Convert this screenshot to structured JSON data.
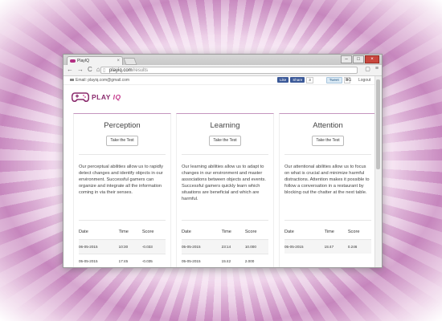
{
  "browser": {
    "tab_title": "PlayIQ",
    "tab_close": "×",
    "url_domain": "playiq.com",
    "url_path": "/results",
    "nav": {
      "back": "←",
      "forward": "→",
      "reload": "C",
      "home": "⌂"
    },
    "window_buttons": {
      "minimize": "–",
      "maximize": "□",
      "close": "×"
    },
    "menu": "≡",
    "extension": "▢"
  },
  "header": {
    "email_label": "Email: playiq.com@gmail.com",
    "fb_like": "Like",
    "fb_share": "Share",
    "fb_count": "3",
    "tweet": "Tweet",
    "tweet_count": "0",
    "language": "BG",
    "logout": "Logout"
  },
  "logo": {
    "play": "PLAY",
    "iq": "IQ",
    "brand_color": "#8a2b6d"
  },
  "cards": [
    {
      "title": "Perception",
      "button": "Take the Test",
      "description": "Our perceptual abilities allow us to rapidly detect changes and identify objects in our environment. Successful gamers can organize and integrate all the information coming in via their senses.",
      "columns": [
        "Date",
        "Time",
        "Score"
      ],
      "rows": [
        [
          "06-05-2015",
          "10:30",
          "-0.033"
        ],
        [
          "05-05-2015",
          "17:45",
          "-0.035"
        ]
      ]
    },
    {
      "title": "Learning",
      "button": "Take the Test",
      "description": "Our learning abilities allow us to adapt to changes in our environment and master associations between objects and events. Successful gamers quickly learn which situations are beneficial and which are harmful.",
      "columns": [
        "Date",
        "Time",
        "Score"
      ],
      "rows": [
        [
          "05-05-2015",
          "23:14",
          "10.000"
        ],
        [
          "05-05-2015",
          "15:42",
          "2.000"
        ]
      ]
    },
    {
      "title": "Attention",
      "button": "Take the Test",
      "description": "Our attentional abilities allow us to focus on what is crucial and minimize harmful distractions. Attention makes it possible to follow a conversation in a restaurant by blocking out the chatter at the next table.",
      "columns": [
        "Date",
        "Time",
        "Score"
      ],
      "rows": [
        [
          "05-05-2015",
          "15:47",
          "0.246"
        ]
      ]
    }
  ]
}
